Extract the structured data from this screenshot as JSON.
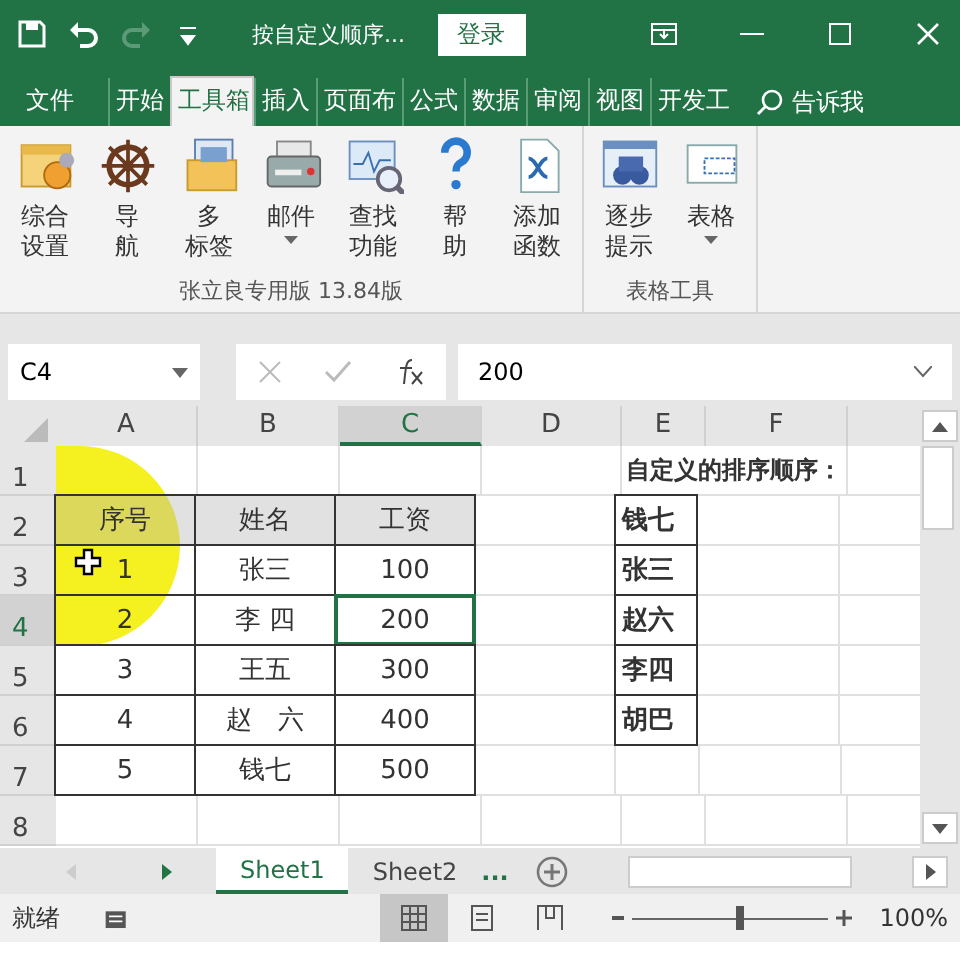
{
  "title_bar": {
    "title": "按自定义顺序...",
    "login": "登录"
  },
  "ribbon_tabs": [
    {
      "label": "文件",
      "selected": false
    },
    {
      "label": "开始",
      "selected": false
    },
    {
      "label": "工具箱",
      "selected": true
    },
    {
      "label": "插入",
      "selected": false
    },
    {
      "label": "页面布",
      "selected": false
    },
    {
      "label": "公式",
      "selected": false
    },
    {
      "label": "数据",
      "selected": false
    },
    {
      "label": "审阅",
      "selected": false
    },
    {
      "label": "视图",
      "selected": false
    },
    {
      "label": "开发工",
      "selected": false
    }
  ],
  "tell_me": "告诉我",
  "ribbon_groups": [
    {
      "label": "张立良专用版 13.84版",
      "buttons": [
        {
          "lines": [
            "综合",
            "设置"
          ],
          "dropdown": false
        },
        {
          "lines": [
            "导",
            "航"
          ],
          "dropdown": false
        },
        {
          "lines": [
            "多",
            "标签"
          ],
          "dropdown": false
        },
        {
          "lines": [
            "邮件"
          ],
          "dropdown": true
        },
        {
          "lines": [
            "查找",
            "功能"
          ],
          "dropdown": false
        },
        {
          "lines": [
            "帮",
            "助"
          ],
          "dropdown": false
        },
        {
          "lines": [
            "添加",
            "函数"
          ],
          "dropdown": false
        }
      ]
    },
    {
      "label": "表格工具",
      "buttons": [
        {
          "lines": [
            "逐步",
            "提示"
          ],
          "dropdown": false
        },
        {
          "lines": [
            "表格"
          ],
          "dropdown": true
        }
      ]
    }
  ],
  "formula_bar": {
    "name_box": "C4",
    "formula": "200"
  },
  "columns": [
    {
      "label": "A",
      "selected": false
    },
    {
      "label": "B",
      "selected": false
    },
    {
      "label": "C",
      "selected": true
    },
    {
      "label": "D",
      "selected": false
    },
    {
      "label": "E",
      "selected": false
    },
    {
      "label": "F",
      "selected": false
    }
  ],
  "row_headers": [
    {
      "label": "1",
      "selected": false
    },
    {
      "label": "2",
      "selected": false
    },
    {
      "label": "3",
      "selected": false
    },
    {
      "label": "4",
      "selected": true
    },
    {
      "label": "5",
      "selected": false
    },
    {
      "label": "6",
      "selected": false
    },
    {
      "label": "7",
      "selected": false
    },
    {
      "label": "8",
      "selected": false
    }
  ],
  "table": {
    "header": [
      "序号",
      "姓名",
      "工资"
    ],
    "rows": [
      [
        {
          "text": "1",
          "selected": false
        },
        {
          "text": "张三",
          "selected": false
        },
        {
          "text": "100",
          "selected": false
        }
      ],
      [
        {
          "text": "2",
          "selected": false
        },
        {
          "text": "李 四",
          "selected": false
        },
        {
          "text": "200",
          "selected": true
        }
      ],
      [
        {
          "text": "3",
          "selected": false
        },
        {
          "text": "王五",
          "selected": false
        },
        {
          "text": "300",
          "selected": false
        }
      ],
      [
        {
          "text": "4",
          "selected": false
        },
        {
          "text": "赵　六",
          "selected": false
        },
        {
          "text": "400",
          "selected": false
        }
      ],
      [
        {
          "text": "5",
          "selected": false
        },
        {
          "text": "钱七",
          "selected": false
        },
        {
          "text": "500",
          "selected": false
        }
      ]
    ]
  },
  "custom_order": {
    "title": "自定义的排序顺序：",
    "items": [
      "钱七",
      "张三",
      "赵六",
      "李四",
      "胡巴"
    ]
  },
  "sheet_tabs": [
    {
      "label": "Sheet1",
      "selected": true
    },
    {
      "label": "Sheet2",
      "selected": false
    }
  ],
  "more_sheets": "...",
  "status_bar": {
    "status": "就绪",
    "view_buttons": [
      {
        "selected": true
      },
      {
        "selected": false
      },
      {
        "selected": false
      }
    ],
    "zoom": {
      "level": 0.55,
      "reading": "100%"
    }
  }
}
